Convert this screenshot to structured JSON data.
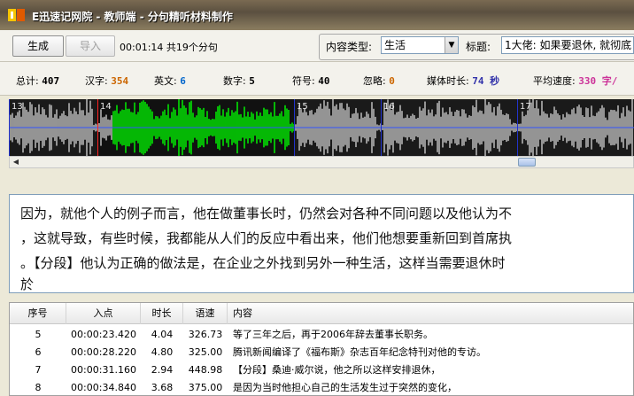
{
  "window": {
    "title": "E迅速记网院 - 教师端 - 分句精听材料制作",
    "accent": "#f5c400"
  },
  "toolbar": {
    "generate_label": "生成",
    "import_label": "导入",
    "status": "00:01:14  共19个分句",
    "content_type_label": "内容类型:",
    "content_type_value": "生活",
    "title_label": "标题:",
    "title_value": "1大佬: 如果要退休, 就彻底"
  },
  "stats": [
    {
      "label": "总计:",
      "value": "407",
      "color": "#000000"
    },
    {
      "label": "汉字:",
      "value": "354",
      "color": "#cc6600"
    },
    {
      "label": "英文:",
      "value": "6",
      "color": "#0066cc"
    },
    {
      "label": "数字:",
      "value": "5",
      "color": "#000000"
    },
    {
      "label": "符号:",
      "value": "40",
      "color": "#000000"
    },
    {
      "label": "忽略:",
      "value": "0",
      "color": "#cc6600"
    },
    {
      "label": "媒体时长:",
      "value": "74 秒",
      "color": "#3333aa"
    },
    {
      "label": "平均速度:",
      "value": "330 字/",
      "color": "#cc3399"
    }
  ],
  "waveform": {
    "segment_labels": [
      "13",
      "14",
      "15",
      "16",
      "17"
    ],
    "selected_color": "#00ff00",
    "wave_color": "#c8c8c8"
  },
  "editor": {
    "lines": [
      "因为，就他个人的例子而言，他在做董事长时，仍然会对各种不同问题以及他认为不",
      "，这就导致，有些时候，我都能从人们的反应中看出来，他们他想要重新回到首席执",
      "。【分段】他认为正确的做法是，在企业之外找到另外一种生活，这样当需要退休时",
      "於"
    ]
  },
  "table": {
    "headers": [
      "序号",
      "入点",
      "时长",
      "语速",
      "内容"
    ],
    "rows": [
      [
        "5",
        "00:00:23.420",
        "4.04",
        "326.73",
        "等了三年之后，再于2006年辞去董事长职务。"
      ],
      [
        "6",
        "00:00:28.220",
        "4.80",
        "325.00",
        "腾讯新闻编译了《福布斯》杂志百年纪念特刊对他的专访。"
      ],
      [
        "7",
        "00:00:31.160",
        "2.94",
        "448.98",
        "【分段】桑迪·威尔说，他之所以这样安排退休，"
      ],
      [
        "8",
        "00:00:34.840",
        "3.68",
        "375.00",
        "是因为当时他担心自己的生活发生过于突然的变化，"
      ]
    ]
  }
}
